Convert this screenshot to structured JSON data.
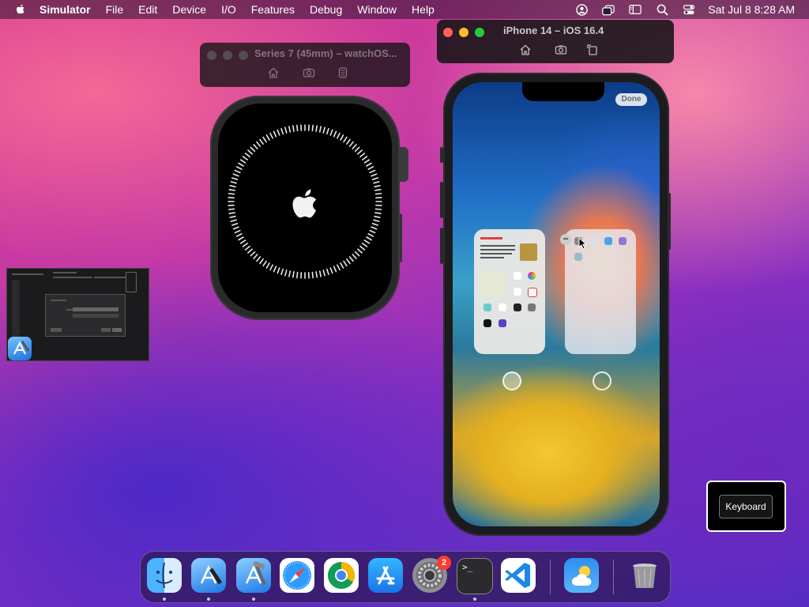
{
  "menubar": {
    "app_name": "Simulator",
    "items": [
      "File",
      "Edit",
      "Device",
      "I/O",
      "Features",
      "Debug",
      "Window",
      "Help"
    ],
    "clock": "Sat Jul 8  8:28 AM"
  },
  "watch_window": {
    "title": "Series 7 (45mm) – watchOS..."
  },
  "iphone_window": {
    "title": "iPhone 14 – iOS 16.4"
  },
  "iphone": {
    "done_label": "Done",
    "minus_label": "−"
  },
  "keyboard_hud": {
    "label": "Keyboard"
  },
  "dock": {
    "settings_badge": "2",
    "terminal_prompt": ">_"
  },
  "colors": {
    "traffic_red": "#ff5f57",
    "traffic_yellow": "#febc2e",
    "traffic_green": "#28c840",
    "badge_red": "#ff3b30"
  }
}
